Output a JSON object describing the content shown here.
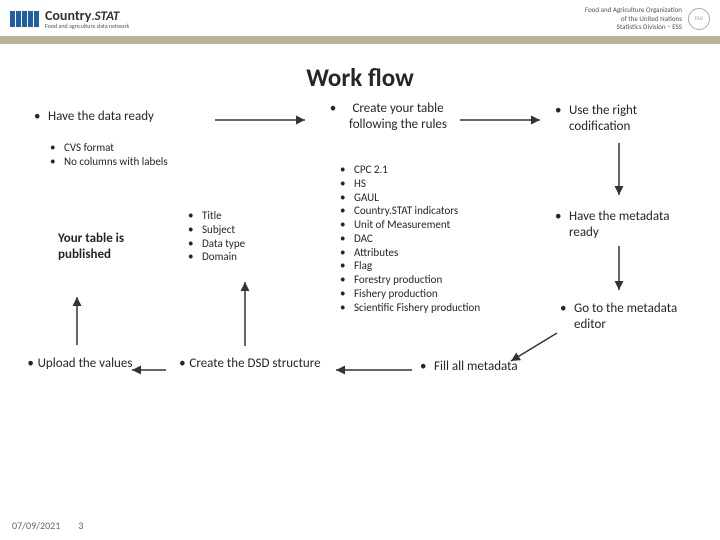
{
  "header": {
    "brand_main": "Country",
    "brand_suffix": "STAT",
    "brand_tagline": "Food and agriculture data network",
    "org_line1": "Food and Agriculture Organization",
    "org_line2": "of the United Nations",
    "org_line3": "Statistics Division – ESS"
  },
  "title": "Work flow",
  "steps": {
    "have_data": "Have the data ready",
    "have_data_sub": [
      "CVS format",
      "No columns with labels"
    ],
    "published": "Your table is published",
    "upload": "Upload the values",
    "dsd": "Create the DSD structure",
    "dsd_items": [
      "Title",
      "Subject",
      "Data type",
      "Domain"
    ],
    "create_table": "Create your table following the rules",
    "rules_items": [
      "CPC 2.1",
      "HS",
      "GAUL",
      "Country.STAT indicators",
      "Unit of Measurement",
      "DAC",
      "Attributes",
      "Flag",
      "Forestry production",
      "Fishery production",
      "Scientific Fishery production"
    ],
    "codification": "Use the right codification",
    "metadata_ready": "Have the metadata ready",
    "goto_editor": "Go to the metadata editor",
    "fill_meta": "Fill all metadata"
  },
  "footer": {
    "date": "07/09/2021",
    "page": "3"
  }
}
